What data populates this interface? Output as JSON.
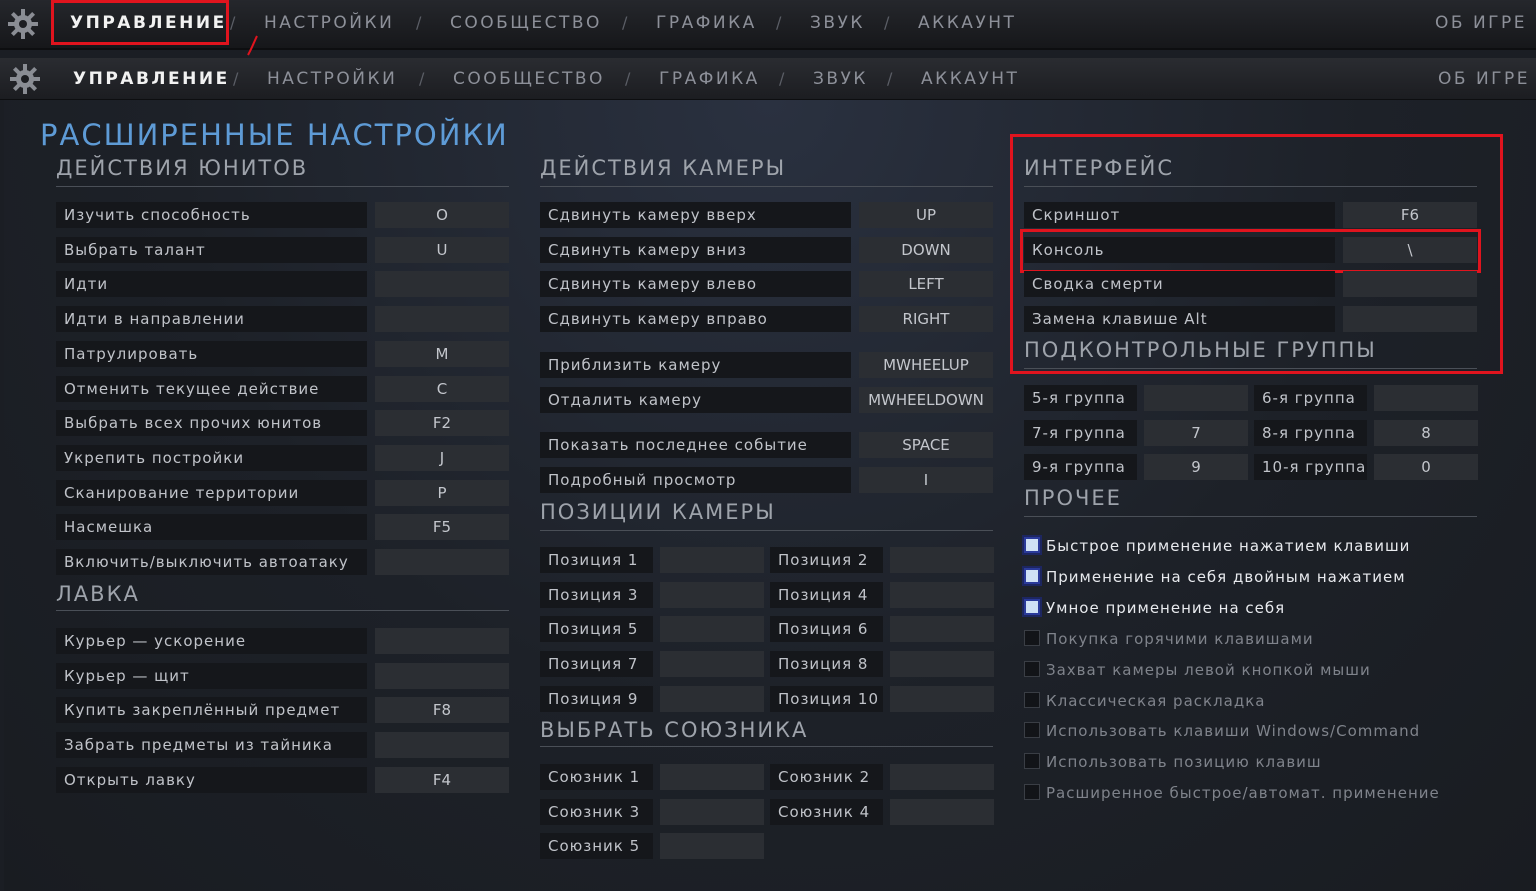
{
  "nav": {
    "items": [
      "УПРАВЛЕНИЕ",
      "НАСТРОЙКИ",
      "СООБЩЕСТВО",
      "ГРАФИКА",
      "ЗВУК",
      "АККАУНТ"
    ],
    "separator": "/",
    "about": "ОБ ИГРЕ"
  },
  "page_title": "РАСШИРЕННЫЕ НАСТРОЙКИ",
  "unit_actions": {
    "title": "ДЕЙСТВИЯ ЮНИТОВ",
    "rows": [
      {
        "label": "Изучить способность",
        "key": "O"
      },
      {
        "label": "Выбрать талант",
        "key": "U"
      },
      {
        "label": "Идти",
        "key": ""
      },
      {
        "label": "Идти в направлении",
        "key": ""
      },
      {
        "label": "Патрулировать",
        "key": "M"
      },
      {
        "label": "Отменить текущее действие",
        "key": "C"
      },
      {
        "label": "Выбрать всех прочих юнитов",
        "key": "F2"
      },
      {
        "label": "Укрепить постройки",
        "key": "J"
      },
      {
        "label": "Сканирование территории",
        "key": "P"
      },
      {
        "label": "Насмешка",
        "key": "F5"
      },
      {
        "label": "Включить/выключить автоатаку",
        "key": ""
      }
    ]
  },
  "shop": {
    "title": "ЛАВКА",
    "rows": [
      {
        "label": "Курьер — ускорение",
        "key": ""
      },
      {
        "label": "Курьер — щит",
        "key": ""
      },
      {
        "label": "Купить закреплённый предмет",
        "key": "F8"
      },
      {
        "label": "Забрать предметы из тайника",
        "key": ""
      },
      {
        "label": "Открыть лавку",
        "key": "F4"
      }
    ]
  },
  "camera_actions": {
    "title": "ДЕЙСТВИЯ КАМЕРЫ",
    "rows": [
      {
        "label": "Сдвинуть камеру вверх",
        "key": "UP"
      },
      {
        "label": "Сдвинуть камеру вниз",
        "key": "DOWN"
      },
      {
        "label": "Сдвинуть камеру влево",
        "key": "LEFT"
      },
      {
        "label": "Сдвинуть камеру вправо",
        "key": "RIGHT"
      },
      {
        "label": "Приблизить камеру",
        "key": "MWHEELUP"
      },
      {
        "label": "Отдалить камеру",
        "key": "MWHEELDOWN"
      },
      {
        "label": "Показать последнее событие",
        "key": "SPACE"
      },
      {
        "label": "Подробный просмотр",
        "key": "I"
      }
    ]
  },
  "camera_positions": {
    "title": "ПОЗИЦИИ КАМЕРЫ",
    "items": [
      {
        "label": "Позиция 1",
        "key": ""
      },
      {
        "label": "Позиция 2",
        "key": ""
      },
      {
        "label": "Позиция 3",
        "key": ""
      },
      {
        "label": "Позиция 4",
        "key": ""
      },
      {
        "label": "Позиция 5",
        "key": ""
      },
      {
        "label": "Позиция 6",
        "key": ""
      },
      {
        "label": "Позиция 7",
        "key": ""
      },
      {
        "label": "Позиция 8",
        "key": ""
      },
      {
        "label": "Позиция 9",
        "key": ""
      },
      {
        "label": "Позиция 10",
        "key": ""
      }
    ]
  },
  "select_ally": {
    "title": "ВЫБРАТЬ СОЮЗНИКА",
    "items": [
      {
        "label": "Союзник 1",
        "key": ""
      },
      {
        "label": "Союзник 2",
        "key": ""
      },
      {
        "label": "Союзник 3",
        "key": ""
      },
      {
        "label": "Союзник 4",
        "key": ""
      },
      {
        "label": "Союзник 5",
        "key": ""
      }
    ]
  },
  "interface": {
    "title": "ИНТЕРФЕЙС",
    "rows": [
      {
        "label": "Скриншот",
        "key": "F6"
      },
      {
        "label": "Консоль",
        "key": "\\"
      },
      {
        "label": "Сводка смерти",
        "key": ""
      },
      {
        "label": "Замена клавише Alt",
        "key": ""
      }
    ]
  },
  "control_groups": {
    "title": "ПОДКОНТРОЛЬНЫЕ ГРУППЫ",
    "items": [
      {
        "label": "5-я группа",
        "key": ""
      },
      {
        "label": "6-я группа",
        "key": ""
      },
      {
        "label": "7-я группа",
        "key": "7"
      },
      {
        "label": "8-я группа",
        "key": "8"
      },
      {
        "label": "9-я группа",
        "key": "9"
      },
      {
        "label": "10-я группа",
        "key": "0"
      }
    ]
  },
  "other": {
    "title": "ПРОЧЕЕ",
    "options": [
      {
        "label": "Быстрое применение нажатием клавиши",
        "checked": true
      },
      {
        "label": "Применение на себя двойным нажатием",
        "checked": true
      },
      {
        "label": "Умное применение на себя",
        "checked": true
      },
      {
        "label": "Покупка горячими клавишами",
        "checked": false
      },
      {
        "label": "Захват камеры левой кнопкой мыши",
        "checked": false
      },
      {
        "label": "Классическая раскладка",
        "checked": false
      },
      {
        "label": "Использовать клавиши Windows/Command",
        "checked": false
      },
      {
        "label": "Использовать позицию клавиш",
        "checked": false
      },
      {
        "label": "Расширенное быстрое/автомат. применение",
        "checked": false
      }
    ]
  },
  "colors": {
    "accent_title": "#5e9bd6",
    "highlight_red": "#e0141e"
  }
}
